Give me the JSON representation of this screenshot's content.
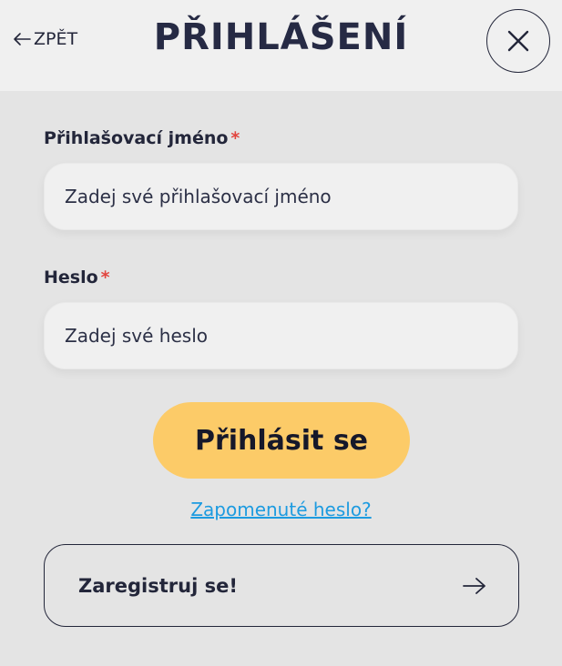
{
  "header": {
    "back_label": "ZPĚT",
    "title": "PŘIHLÁŠENÍ",
    "close_icon": "close-icon"
  },
  "form": {
    "username": {
      "label": "Přihlašovací jméno",
      "required_mark": "*",
      "placeholder": "Zadej své přihlašovací jméno",
      "value": ""
    },
    "password": {
      "label": "Heslo",
      "required_mark": "*",
      "placeholder": "Zadej své heslo",
      "value": ""
    },
    "submit_label": "Přihlásit se",
    "forgot_label": "Zapomenuté heslo?",
    "register_label": "Zaregistruj se!"
  },
  "colors": {
    "header_bg": "#f0f0f0",
    "page_bg": "#e4e4e4",
    "primary_button": "#fccb68",
    "link": "#1d9be0",
    "required": "#e2453f",
    "text": "#23263a"
  }
}
